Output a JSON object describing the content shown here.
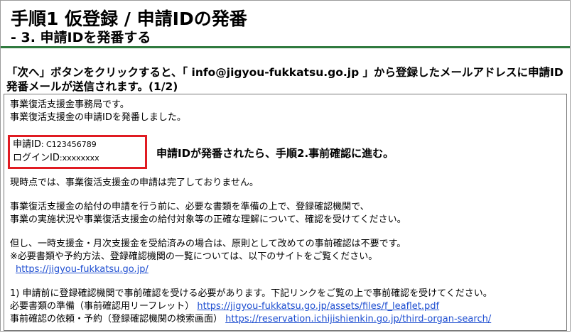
{
  "header": {
    "title": "手順1 仮登録 / 申請IDの発番",
    "subtitle": "- 3. 申請IDを発番する",
    "accent_color": "#2f7a3e"
  },
  "notice": {
    "text": "「次へ」ボタンをクリックすると、「 info@jigyou-fukkatsu.go.jp 」から登録したメールアドレスに申請ID発番メールが送信されます。(1/2)"
  },
  "mail": {
    "greeting1": "事業復活支援金事務局です。",
    "greeting2": "事業復活支援金の申請IDを発番しました。",
    "id_label": "申請ID",
    "id_value": ": C123456789",
    "login_label": "ログインID",
    "login_value": ":xxxxxxxx",
    "callout": "申請IDが発番されたら、手順2.事前確認に進む。",
    "status": "現時点では、事業復活支援金の申請は完了しておりません。",
    "para2_line1": "事業復活支援金の給付の申請を行う前に、必要な書類を準備の上で、登録確認機関で、",
    "para2_line2": "事業の実施状況や事業復活支援金の給付対象等の正確な理解について、確認を受けてください。",
    "para3_line1": "但し、一時支援金・月次支援金を受給済みの場合は、原則として改めての事前確認は不要です。",
    "para3_line2": "※必要書類や予約方法、登録確認機関の一覧については、以下のサイトをご覧ください。",
    "site_link": "https://jigyou-fukkatsu.go.jp/",
    "para4_line1": "1) 申請前に登録確認機関で事前確認を受ける必要があります。下記リンクをご覧の上で事前確認を受けてください。",
    "prep_label": "必要書類の準備（事前確認用リーフレット）",
    "prep_link": "https://jigyou-fukkatsu.go.jp/assets/files/f_leaflet.pdf",
    "reserve_label": "事前確認の依頼・予約（登録確認機関の検索画面）",
    "reserve_link": "https://reservation.ichijishienkin.go.jp/third-organ-search/",
    "highlight_color": "#e01b22",
    "link_color": "#1f4fd1"
  }
}
